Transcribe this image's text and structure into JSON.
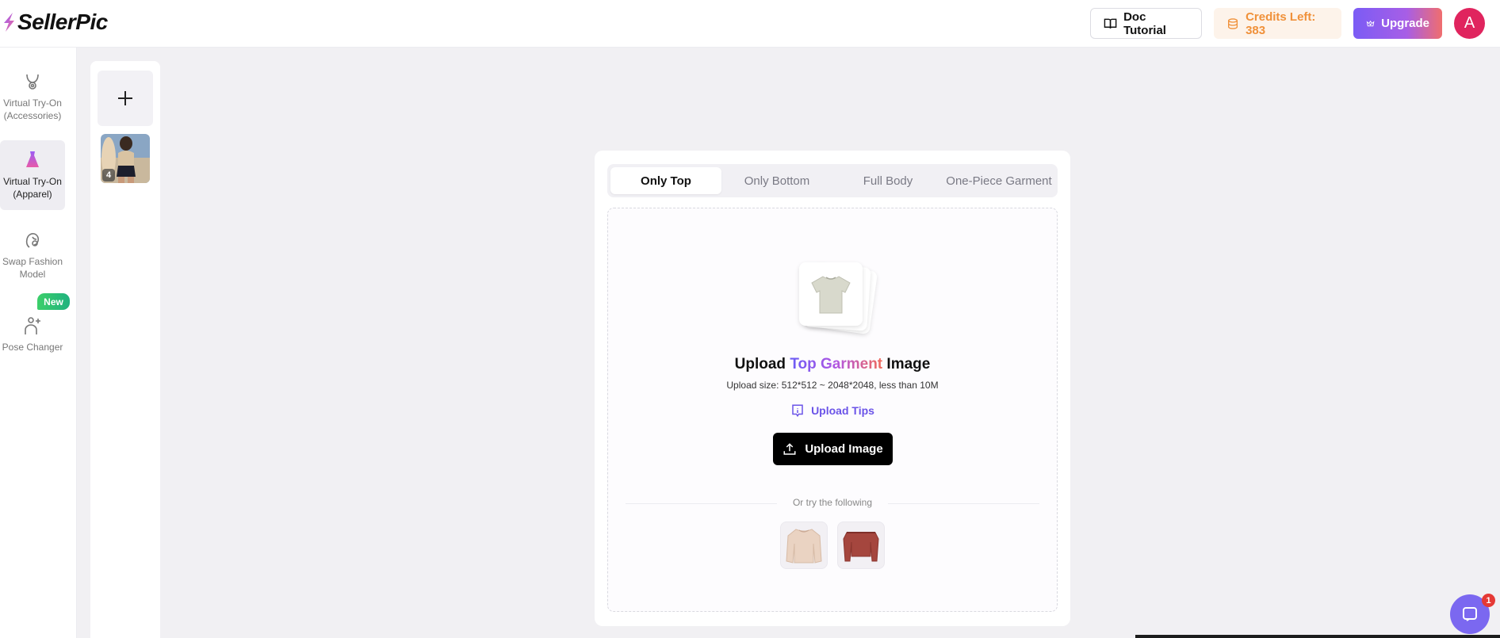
{
  "brand": {
    "name": "SellerPic"
  },
  "header": {
    "doc_tutorial": "Doc Tutorial",
    "credits": "Credits Left: 383",
    "upgrade": "Upgrade",
    "avatar_initial": "A"
  },
  "sidebar": {
    "items": [
      {
        "line1": "Virtual Try-On",
        "line2": "(Accessories)",
        "icon": "necklace-icon"
      },
      {
        "line1": "Virtual Try-On",
        "line2": "(Apparel)",
        "icon": "dress-icon",
        "active": true
      },
      {
        "line1": "Swap Fashion",
        "line2": "Model",
        "icon": "face-swap-icon"
      },
      {
        "line1": "Pose Changer",
        "line2": "",
        "icon": "pose-icon",
        "badge": "New"
      }
    ]
  },
  "history": {
    "count": "4"
  },
  "tabs": [
    "Only Top",
    "Only Bottom",
    "Full Body",
    "One-Piece Garment"
  ],
  "upload": {
    "title_pre": "Upload ",
    "title_highlight": "Top Garment",
    "title_post": " Image",
    "size_text": "Upload size: 512*512 ~ 2048*2048, less than 10M",
    "tips": "Upload Tips",
    "button": "Upload Image"
  },
  "samples": {
    "label": "Or try the following"
  },
  "chat": {
    "badge": "1"
  },
  "colors": {
    "accent": "#6b54e8",
    "credits": "#f0913a",
    "avatar": "#e0245e"
  }
}
